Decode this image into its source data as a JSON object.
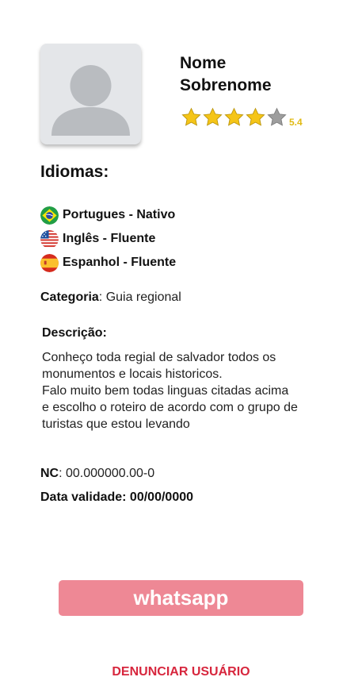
{
  "profile": {
    "first_name": "Nome",
    "last_name": "Sobrenome",
    "rating": 4,
    "rating_max": 5,
    "rating_label": "5.4",
    "star_color_filled": "#f5c518",
    "star_color_empty": "#9e9e9e"
  },
  "languages": {
    "title": "Idiomas:",
    "items": [
      {
        "icon": "brazil-flag-icon",
        "label": "Portugues - Nativo"
      },
      {
        "icon": "usa-flag-icon",
        "label": "Inglês - Fluente"
      },
      {
        "icon": "spain-flag-icon",
        "label": "Espanhol - Fluente"
      }
    ]
  },
  "category": {
    "label": "Categoria",
    "value": ": Guia regional"
  },
  "description": {
    "title": "Descrição:",
    "lines": [
      "Conheço toda regial de salvador todos os",
      "monumentos e locais historicos.",
      "Falo muito bem todas linguas citadas acima",
      "e escolho o roteiro de acordo com o grupo de",
      "turistas que estou levando"
    ]
  },
  "nc": {
    "label": "NC",
    "value": ": 00.000000.00-0"
  },
  "validity": {
    "text": "Data validade: 00/00/0000"
  },
  "actions": {
    "whatsapp_label": "whatsapp",
    "whatsapp_color": "#ee8895",
    "report_label": "DENUNCIAR USUÁRIO",
    "report_color": "#d7263d"
  }
}
